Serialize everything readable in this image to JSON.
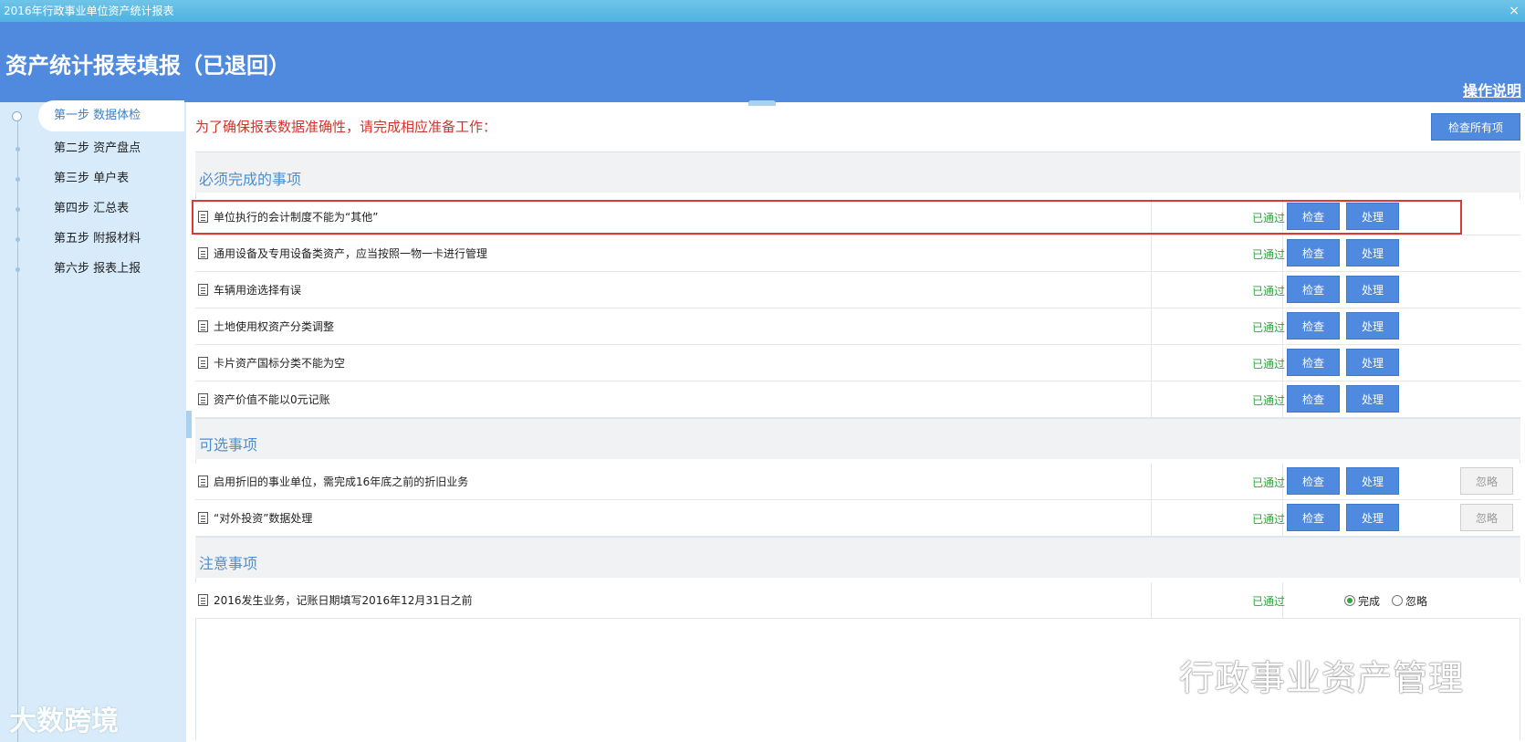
{
  "window": {
    "title": "2016年行政事业单位资产统计报表",
    "close": "×"
  },
  "header": {
    "title": "资产统计报表填报（已退回）",
    "help": "操作说明"
  },
  "steps": [
    {
      "label": "第一步 数据体检",
      "active": true
    },
    {
      "label": "第二步 资产盘点"
    },
    {
      "label": "第三步 单户表"
    },
    {
      "label": "第四步 汇总表"
    },
    {
      "label": "第五步 附报材料"
    },
    {
      "label": "第六步 报表上报"
    }
  ],
  "intro": "为了确保报表数据准确性，请完成相应准备工作：",
  "check_all": "检查所有项",
  "buttons": {
    "check": "检查",
    "handle": "处理",
    "ignore": "忽略"
  },
  "sections": {
    "required": {
      "title": "必须完成的事项",
      "items": [
        {
          "label": "单位执行的会计制度不能为“其他”",
          "status": "已通过"
        },
        {
          "label": "通用设备及专用设备类资产，应当按照一物一卡进行管理",
          "status": "已通过"
        },
        {
          "label": "车辆用途选择有误",
          "status": "已通过"
        },
        {
          "label": "土地使用权资产分类调整",
          "status": "已通过"
        },
        {
          "label": "卡片资产国标分类不能为空",
          "status": "已通过"
        },
        {
          "label": "资产价值不能以0元记账",
          "status": "已通过"
        }
      ]
    },
    "optional": {
      "title": "可选事项",
      "items": [
        {
          "label": "启用折旧的事业单位，需完成16年底之前的折旧业务",
          "status": "已通过"
        },
        {
          "label": "“对外投资”数据处理",
          "status": "已通过"
        }
      ]
    },
    "notice": {
      "title": "注意事项",
      "items": [
        {
          "label": "2016发生业务，记账日期填写2016年12月31日之前",
          "status": "已通过",
          "radio": {
            "done": "完成",
            "ignore": "忽略",
            "selected": "done"
          }
        }
      ]
    }
  },
  "watermarks": {
    "left": "大数跨境",
    "right": "行政事业资产管理"
  },
  "colors": {
    "accent": "#4f8ade",
    "pass": "#2aa63a",
    "intro": "#d0352c",
    "highlight": "#d83a3a"
  }
}
